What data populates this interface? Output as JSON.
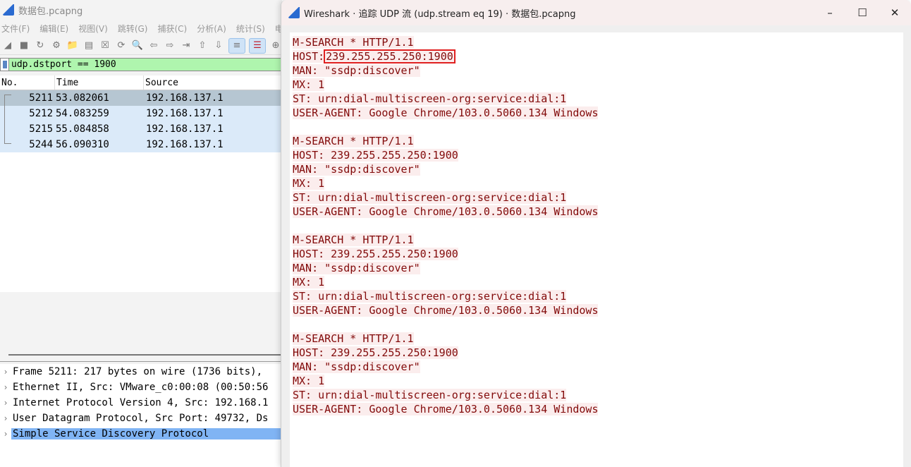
{
  "main": {
    "title": "数据包.pcapng",
    "menu": [
      "文件(F)",
      "编辑(E)",
      "视图(V)",
      "跳转(G)",
      "捕获(C)",
      "分析(A)",
      "统计(S)",
      "电"
    ],
    "toolbar": [
      "shark-fin-start-icon",
      "stop-icon",
      "restart-icon",
      "options-gear-icon",
      "open-folder-icon",
      "save-file-icon",
      "close-file-icon",
      "reload-icon",
      "find-icon",
      "back-arrow-icon",
      "forward-arrow-icon",
      "goto-packet-icon",
      "first-packet-icon",
      "last-packet-icon",
      "autoscroll-icon",
      "colorize-icon",
      "zoom-in-icon"
    ],
    "filter": "udp.dstport == 1900",
    "columns": [
      "No.",
      "Time",
      "Source"
    ],
    "packets": [
      {
        "no": "5211",
        "time": "53.082061",
        "src": "192.168.137.1"
      },
      {
        "no": "5212",
        "time": "54.083259",
        "src": "192.168.137.1"
      },
      {
        "no": "5215",
        "time": "55.084858",
        "src": "192.168.137.1"
      },
      {
        "no": "5244",
        "time": "56.090310",
        "src": "192.168.137.1"
      }
    ],
    "details": [
      "Frame 5211: 217 bytes on wire (1736 bits),",
      "Ethernet II, Src: VMware_c0:00:08 (00:50:56",
      "Internet Protocol Version 4, Src: 192.168.1",
      "User Datagram Protocol, Src Port: 49732, Ds",
      "Simple Service Discovery Protocol"
    ]
  },
  "dialog": {
    "title": "Wireshark · 追踪 UDP 流 (udp.stream eq 19) · 数据包.pcapng",
    "controls": {
      "minimize": "–",
      "maximize": "☐",
      "close": "✕"
    },
    "highlight_color": "#e02020",
    "text_color": "#820a0a",
    "messages": [
      {
        "l1": "M-SEARCH * HTTP/1.1",
        "host_label": "HOST:",
        "host": "239.255.255.250:1900",
        "l3": "MAN: \"ssdp:discover\"",
        "l4": "MX: 1",
        "l5": "ST: urn:dial-multiscreen-org:service:dial:1",
        "l6": "USER-AGENT: Google Chrome/103.0.5060.134 Windows"
      },
      {
        "l1": "M-SEARCH * HTTP/1.1",
        "host_label": "HOST:",
        "host": "239.255.255.250:1900",
        "l3": "MAN: \"ssdp:discover\"",
        "l4": "MX: 1",
        "l5": "ST: urn:dial-multiscreen-org:service:dial:1",
        "l6": "USER-AGENT: Google Chrome/103.0.5060.134 Windows"
      },
      {
        "l1": "M-SEARCH * HTTP/1.1",
        "host_label": "HOST:",
        "host": "239.255.255.250:1900",
        "l3": "MAN: \"ssdp:discover\"",
        "l4": "MX: 1",
        "l5": "ST: urn:dial-multiscreen-org:service:dial:1",
        "l6": "USER-AGENT: Google Chrome/103.0.5060.134 Windows"
      },
      {
        "l1": "M-SEARCH * HTTP/1.1",
        "host_label": "HOST:",
        "host": "239.255.255.250:1900",
        "l3": "MAN: \"ssdp:discover\"",
        "l4": "MX: 1",
        "l5": "ST: urn:dial-multiscreen-org:service:dial:1",
        "l6": "USER-AGENT: Google Chrome/103.0.5060.134 Windows"
      }
    ]
  }
}
